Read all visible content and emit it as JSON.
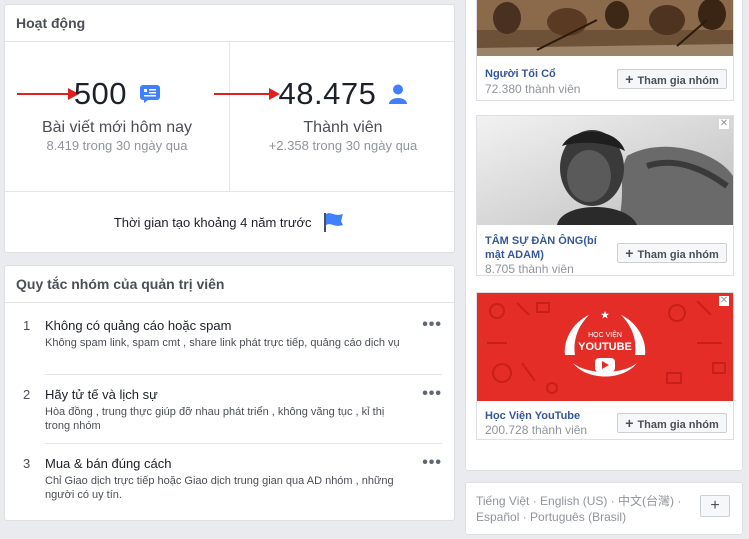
{
  "activity": {
    "title": "Hoạt động",
    "posts": {
      "value": "500",
      "label": "Bài viết mới hôm nay",
      "sub": "8.419 trong 30 ngày qua"
    },
    "members": {
      "value": "48.475",
      "label": "Thành viên",
      "sub": "+2.358 trong 30 ngày qua"
    },
    "created": "Thời gian tạo khoảng 4 năm trước"
  },
  "rules": {
    "title": "Quy tắc nhóm của quản trị viên",
    "items": [
      {
        "num": "1",
        "title": "Không có quảng cáo hoặc spam",
        "desc": "Không spam link, spam cmt , share link phát trực tiếp, quảng cáo dịch vụ"
      },
      {
        "num": "2",
        "title": "Hãy tử tế và lịch sự",
        "desc": "Hòa đồng , trung thực giúp đỡ nhau phát triển , không văng tục , kỉ thị trong nhóm"
      },
      {
        "num": "3",
        "title": "Mua & bán đúng cách",
        "desc": "Chỉ Giao dịch trực tiếp hoặc Giao dịch trung gian qua AD nhóm , những người có uy tín."
      }
    ],
    "more": "•••"
  },
  "groups": [
    {
      "name": "Người Tối Cổ",
      "members": "72.380 thành viên",
      "join": "Tham gia nhóm"
    },
    {
      "name": "TÂM SỰ ĐÀN ÔNG(bí mật ADAM)",
      "members": "8.705 thành viên",
      "join": "Tham gia nhóm"
    },
    {
      "name": "Học Viện YouTube",
      "members": "200.728 thành viên",
      "join": "Tham gia nhóm",
      "badge_top": "HỌC VIỆN",
      "badge_main": "YOUTUBE"
    }
  ],
  "languages": {
    "text": "Tiếng Việt · English (US) · 中文(台灣) · Español · Português (Brasil)",
    "add": "+"
  },
  "colors": {
    "accent": "#365899",
    "arrow": "#e02020",
    "youtube_red": "#e52d27"
  }
}
